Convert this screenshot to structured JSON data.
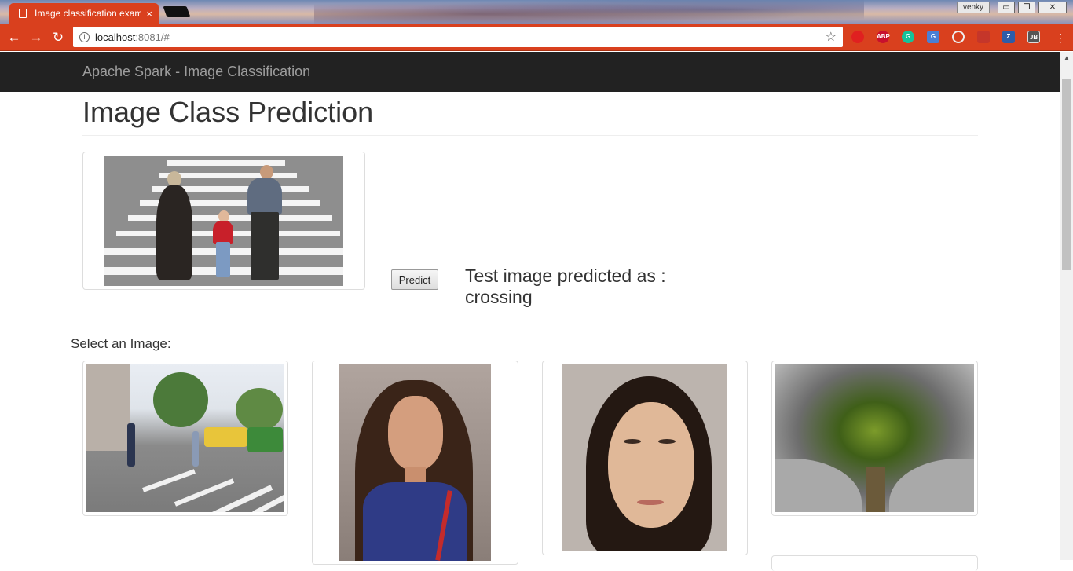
{
  "browser": {
    "tab_title": "Image classification exam",
    "tab_close": "×",
    "profile": "venky",
    "url_host": "localhost",
    "url_path": ":8081/#",
    "win_min": "▭",
    "win_restore": "❐",
    "win_close": "✕",
    "extensions": [
      "opera-icon",
      "adblock-icon",
      "grammarly-icon",
      "translate-icon",
      "search-icon",
      "pdf-icon",
      "zotero-icon",
      "jb-icon"
    ],
    "ext_labels": [
      "",
      "ABP",
      "G",
      "G",
      "",
      "",
      "Z",
      "JB"
    ]
  },
  "navbar": {
    "brand": "Apache Spark - Image Classification"
  },
  "main": {
    "title": "Image Class Prediction",
    "predict_label": "Predict",
    "result_line1": "Test image predicted as :",
    "result_line2": "crossing",
    "select_label": "Select an Image:"
  },
  "gallery": [
    {
      "name": "street-crossing-image"
    },
    {
      "name": "woman-portrait-image"
    },
    {
      "name": "woman-face-image"
    },
    {
      "name": "forest-road-image"
    }
  ]
}
